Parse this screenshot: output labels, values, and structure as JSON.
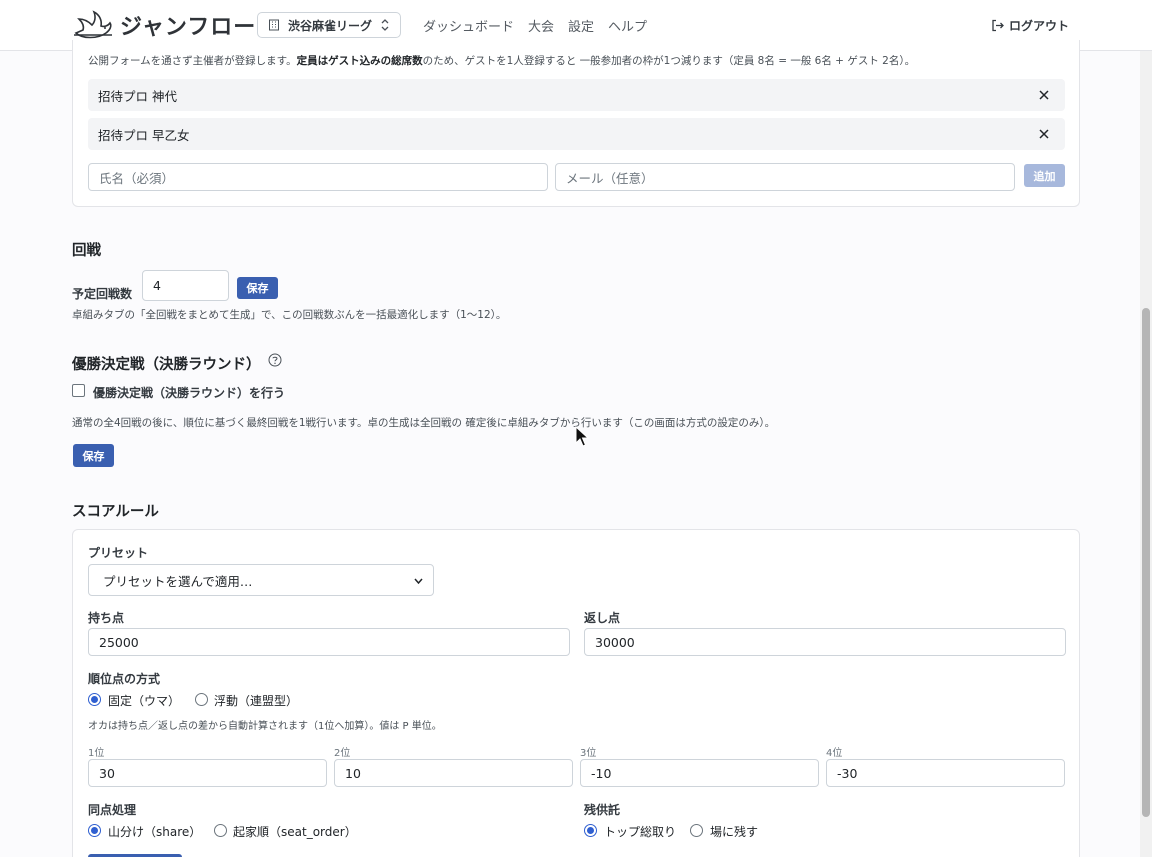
{
  "header": {
    "logo_text": "ジャンフロー",
    "org_select": "渋谷麻雀リーグ",
    "nav": [
      "ダッシュボード",
      "大会",
      "設定",
      "ヘルプ"
    ],
    "logout": "ログアウト"
  },
  "guests": {
    "note_prefix": "公開フォームを通さず主催者が登録します。",
    "note_bold": "定員はゲスト込みの総席数",
    "note_suffix": "のため、ゲストを1人登録すると 一般参加者の枠が1つ減ります（定員 8名 = 一般 6名 + ゲスト 2名）。",
    "items": [
      {
        "name": "招待プロ 神代"
      },
      {
        "name": "招待プロ 早乙女"
      }
    ],
    "name_placeholder": "氏名（必須）",
    "email_placeholder": "メール（任意）",
    "add_label": "追加"
  },
  "rounds": {
    "title": "回戦",
    "planned_label": "予定回戦数",
    "planned_value": "4",
    "save_label": "保存",
    "help": "卓組みタブの「全回戦をまとめて生成」で、この回戦数ぶんを一括最適化します（1〜12）。"
  },
  "final": {
    "title": "優勝決定戦（決勝ラウンド）",
    "checkbox_label": "優勝決定戦（決勝ラウンド）を行う",
    "checked": false,
    "help": "通常の全4回戦の後に、順位に基づく最終回戦を1戦行います。卓の生成は全回戦の 確定後に卓組みタブから行います（この画面は方式の設定のみ）。",
    "save_label": "保存"
  },
  "score": {
    "title": "スコアルール",
    "preset_label": "プリセット",
    "preset_value": "プリセットを選んで適用…",
    "start_label": "持ち点",
    "start_value": "25000",
    "return_label": "返し点",
    "return_value": "30000",
    "uma_label": "順位点の方式",
    "uma_options": [
      "固定（ウマ）",
      "浮動（連盟型）"
    ],
    "uma_selected": 0,
    "oka_note": "オカは持ち点／返し点の差から自動計算されます（1位へ加算）。値は P 単位。",
    "ranks": [
      {
        "label": "1位",
        "value": "30"
      },
      {
        "label": "2位",
        "value": "10"
      },
      {
        "label": "3位",
        "value": "-10"
      },
      {
        "label": "4位",
        "value": "-30"
      }
    ],
    "tie_label": "同点処理",
    "tie_options": [
      "山分け（share）",
      "起家順（seat_order）"
    ],
    "tie_selected": 0,
    "kyotaku_label": "残供託",
    "kyotaku_options": [
      "トップ総取り",
      "場に残す"
    ],
    "kyotaku_selected": 0
  }
}
